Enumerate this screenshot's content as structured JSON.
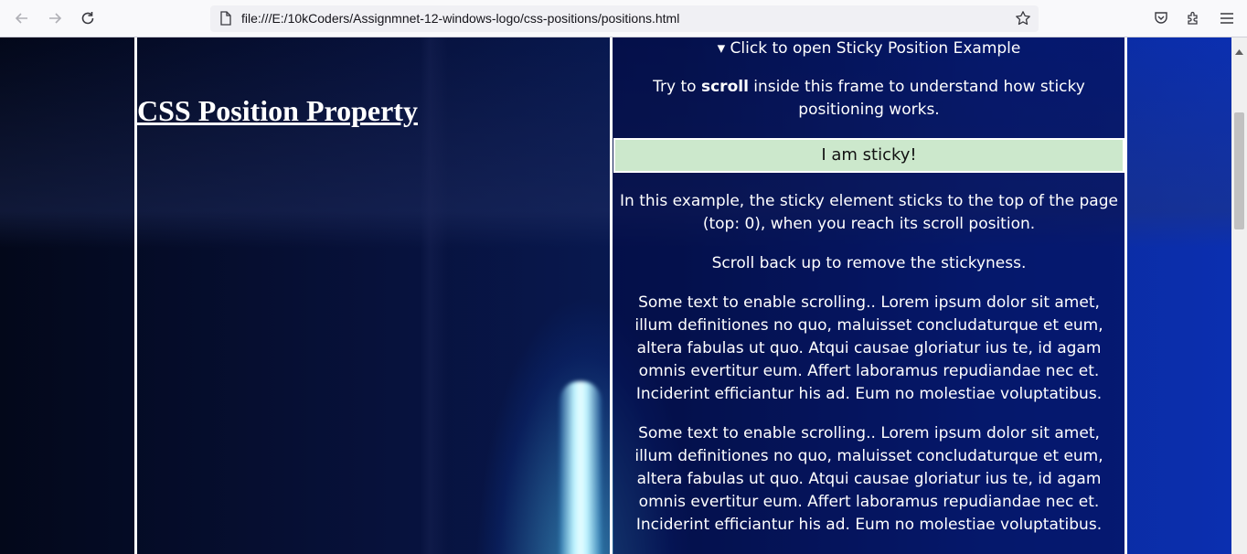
{
  "browser": {
    "url": "file:///E:/10kCoders/Assignmnet-12-windows-logo/css-positions/positions.html",
    "icons": {
      "back": "arrow-left-icon",
      "forward": "arrow-right-icon",
      "reload": "reload-icon",
      "page": "page-icon",
      "bookmark": "star-icon",
      "pocket": "pocket-icon",
      "extensions": "puzzle-icon",
      "menu": "hamburger-menu-icon"
    }
  },
  "page": {
    "title": "CSS Position Property",
    "details_summary": "▾ Click to open Sticky Position Example",
    "intro_before": "Try to ",
    "intro_bold": "scroll",
    "intro_after": " inside this frame to understand how sticky positioning works.",
    "sticky_label": "I am sticky!",
    "paragraphs": [
      "In this example, the sticky element sticks to the top of the page (top: 0), when you reach its scroll position.",
      "Scroll back up to remove the stickyness.",
      "Some text to enable scrolling.. Lorem ipsum dolor sit amet, illum definitiones no quo, maluisset concludaturque et eum, altera fabulas ut quo. Atqui causae gloriatur ius te, id agam omnis evertitur eum. Affert laboramus repudiandae nec et. Inciderint efficiantur his ad. Eum no molestiae voluptatibus.",
      "Some text to enable scrolling.. Lorem ipsum dolor sit amet, illum definitiones no quo, maluisset concludaturque et eum, altera fabulas ut quo. Atqui causae gloriatur ius te, id agam omnis evertitur eum. Affert laboramus repudiandae nec et. Inciderint efficiantur his ad. Eum no molestiae voluptatibus."
    ]
  },
  "colors": {
    "sticky_bg": "#cce8cc",
    "text": "#ffffff",
    "column_border": "#ffffff"
  }
}
